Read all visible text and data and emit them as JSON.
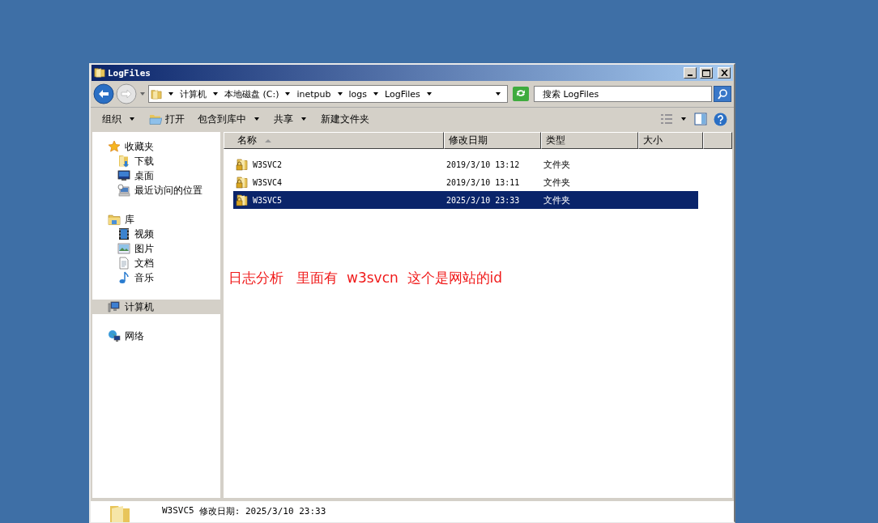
{
  "window": {
    "title": "LogFiles"
  },
  "address_bar": {
    "crumbs": [
      "计算机",
      "本地磁盘 (C:)",
      "inetpub",
      "logs",
      "LogFiles"
    ]
  },
  "search": {
    "placeholder": "搜索 LogFiles"
  },
  "toolbar": [
    {
      "label": "组织",
      "kind": "menu",
      "dropdown": true
    },
    {
      "label": "打开",
      "kind": "open",
      "dropdown": false
    },
    {
      "label": "包含到库中",
      "kind": "menu",
      "dropdown": true
    },
    {
      "label": "共享",
      "kind": "menu",
      "dropdown": true
    },
    {
      "label": "新建文件夹",
      "kind": "menu",
      "dropdown": false
    }
  ],
  "sidebar": {
    "groups": [
      {
        "label": "收藏夹",
        "kind": "star",
        "selected": false,
        "children": [
          {
            "label": "下载",
            "kind": "download"
          },
          {
            "label": "桌面",
            "kind": "desktop"
          },
          {
            "label": "最近访问的位置",
            "kind": "recent"
          }
        ]
      },
      {
        "label": "库",
        "kind": "library",
        "selected": false,
        "children": [
          {
            "label": "视频",
            "kind": "video"
          },
          {
            "label": "图片",
            "kind": "image"
          },
          {
            "label": "文档",
            "kind": "document"
          },
          {
            "label": "音乐",
            "kind": "music"
          }
        ]
      },
      {
        "label": "计算机",
        "kind": "computer",
        "selected": true
      },
      {
        "label": "网络",
        "kind": "network",
        "selected": false
      }
    ]
  },
  "table": {
    "columns": [
      {
        "label": "名称",
        "sorted": true
      },
      {
        "label": "修改日期",
        "sorted": false
      },
      {
        "label": "类型",
        "sorted": false
      },
      {
        "label": "大小",
        "sorted": false
      }
    ],
    "rows": [
      {
        "name": "W3SVC2",
        "date": "2019/3/10 13:12",
        "type": "文件夹",
        "selected": false
      },
      {
        "name": "W3SVC4",
        "date": "2019/3/10 13:11",
        "type": "文件夹",
        "selected": false
      },
      {
        "name": "W3SVC5",
        "date": "2025/3/10 23:33",
        "type": "文件夹",
        "selected": true
      }
    ]
  },
  "annotation": "日志分析   里面有  w3svcn  这个是网站的id",
  "details_pane": {
    "name": "W3SVC5",
    "modified": "修改日期: 2025/3/10 23:33"
  }
}
